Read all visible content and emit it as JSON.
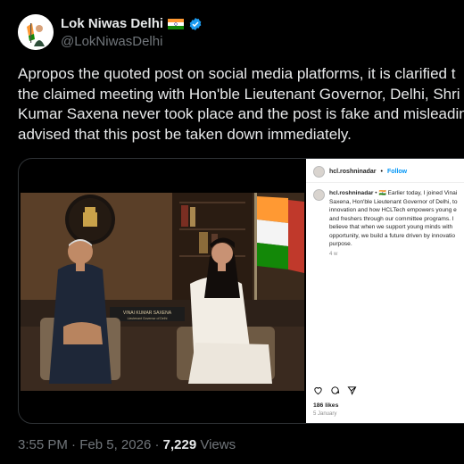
{
  "post": {
    "author_name": "Lok Niwas Delhi",
    "handle": "@LokNiwasDelhi",
    "text_lines": [
      "Apropos the quoted post on social media platforms, it is clarified t",
      "the claimed meeting with Hon'ble Lieutenant Governor, Delhi, Shri",
      "Kumar Saxena never took place and the post is fake and misleadin",
      "advised that this post be taken down immediately."
    ],
    "time": "3:55 PM",
    "date": "Feb 5, 2026",
    "views_count": "7,229",
    "views_label": "Views"
  },
  "quoted": {
    "photo": {
      "nameplate_name": "VINAI KUMAR SAXENA",
      "nameplate_title": "Lieutenant Governor of Delhi"
    },
    "instagram": {
      "username": "hcl.roshninadar",
      "follow_label": "Follow",
      "caption_username": "hcl.roshninadar",
      "caption_lines": [
        " • 🇮🇳 Earlier today, I joined Vinai",
        "Saxena, Hon'ble Lieutenant Governor of Delhi, to",
        "innovation and how HCLTech empowers young e",
        "and freshers through our committee programs. I",
        "believe that when we support young minds with",
        "opportunity, we build a future driven by innovatio",
        "purpose."
      ],
      "caption_age": "4 w",
      "likes": "186 likes",
      "post_date": "5 January"
    }
  },
  "colors": {
    "verified": "#1d9bf0",
    "follow": "#0095f6",
    "muted": "#71767b"
  },
  "icons": [
    "india-flag-icon",
    "verified-badge-icon",
    "heart-icon",
    "comment-icon",
    "share-icon"
  ]
}
